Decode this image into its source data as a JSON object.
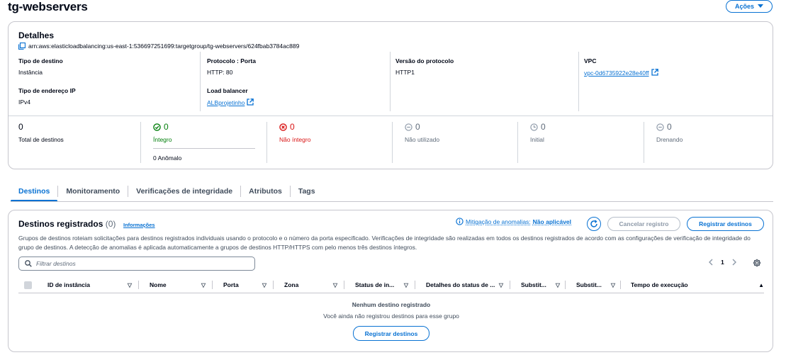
{
  "header": {
    "title": "tg-webservers",
    "actions_label": "Ações"
  },
  "details": {
    "title": "Detalhes",
    "arn": "arn:aws:elasticloadbalancing:us-east-1:536697251699:targetgroup/tg-webservers/624fbab3784ac889",
    "fields": {
      "target_type": {
        "label": "Tipo de destino",
        "value": "Instância"
      },
      "protocol_port": {
        "label": "Protocolo : Porta",
        "value": "HTTP: 80"
      },
      "protocol_version": {
        "label": "Versão do protocolo",
        "value": "HTTP1"
      },
      "vpc": {
        "label": "VPC",
        "value": "vpc-0d6735922e28e40ff"
      },
      "ip_address_type": {
        "label": "Tipo de endereço IP",
        "value": "IPv4"
      },
      "load_balancer": {
        "label": "Load balancer",
        "value": "ALBprojetinho"
      }
    },
    "stats": {
      "total": {
        "value": "0",
        "label": "Total de destinos"
      },
      "healthy": {
        "value": "0",
        "label": "Íntegro",
        "anomalous": "0 Anômalo"
      },
      "unhealthy": {
        "value": "0",
        "label": "Não íntegro"
      },
      "unused": {
        "value": "0",
        "label": "Não utilizado"
      },
      "initial": {
        "value": "0",
        "label": "Initial"
      },
      "draining": {
        "value": "0",
        "label": "Drenando"
      }
    }
  },
  "tabs": [
    {
      "label": "Destinos",
      "active": true
    },
    {
      "label": "Monitoramento"
    },
    {
      "label": "Verificações de integridade"
    },
    {
      "label": "Atributos"
    },
    {
      "label": "Tags"
    }
  ],
  "targets": {
    "title": "Destinos registrados",
    "count": "(0)",
    "info": "Informações",
    "mitigation_label": "Mitigação de anomalias:",
    "mitigation_value": "Não aplicável",
    "cancel_label": "Cancelar registro",
    "register_label": "Registrar destinos",
    "description": "Grupos de destinos roteiam solicitações para destinos registrados individuais usando o protocolo e o número da porta especificado. Verificações de integridade são realizadas em todos os destinos registrados de acordo com as configurações de verificação de integridade do grupo de destinos. A detecção de anomalias é aplicada automaticamente a grupos de destinos HTTP/HTTPS com pelo menos três destinos íntegros.",
    "filter_placeholder": "Filtrar destinos",
    "page": "1",
    "columns": [
      "ID de instância",
      "Nome",
      "Porta",
      "Zona",
      "Status de in...",
      "Detalhes do status de ...",
      "Substit...",
      "Substit...",
      "Tempo de execução"
    ],
    "empty_title": "Nenhum destino registrado",
    "empty_desc": "Você ainda não registrou destinos para esse grupo",
    "empty_register_label": "Registrar destinos"
  },
  "colors": {
    "accent": "#0972d3",
    "healthy": "#037f0c",
    "unhealthy": "#d91515",
    "muted": "#5f6b7a"
  }
}
